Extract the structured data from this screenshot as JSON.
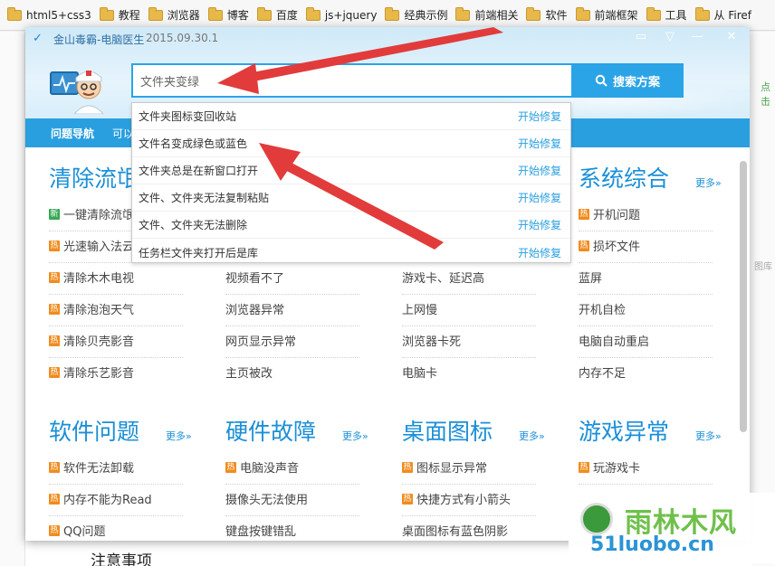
{
  "bookmarks": [
    "html5+css3",
    "教程",
    "浏览器",
    "博客",
    "百度",
    "js+jquery",
    "经典示例",
    "前端相关",
    "软件",
    "前端框架",
    "工具",
    "从 Firef"
  ],
  "background": {
    "right_label": "图库",
    "right_green": "点击",
    "bottom_text": "注意事项"
  },
  "app": {
    "title": "金山毒霸-电脑医生",
    "date": "2015.09.30.1"
  },
  "search": {
    "value": "文件夹变绿",
    "button_label": "搜索方案"
  },
  "nav": {
    "label": "问题导航",
    "extra": "可以"
  },
  "dropdown": [
    {
      "label": "文件夹图标变回收站",
      "action": "开始修复"
    },
    {
      "label": "文件名变成绿色或蓝色",
      "action": "开始修复"
    },
    {
      "label": "文件夹总是在新窗口打开",
      "action": "开始修复"
    },
    {
      "label": "文件、文件夹无法复制粘贴",
      "action": "开始修复"
    },
    {
      "label": "文件、文件夹无法删除",
      "action": "开始修复"
    },
    {
      "label": "任务栏文件夹打开后是库",
      "action": "开始修复"
    }
  ],
  "sections_top": {
    "col1_title": "清除流氓",
    "col4_title": "系统综合",
    "more": "更多»",
    "col1_items": [
      "一键清除流氓",
      "光速输入法云",
      "清除木木电视",
      "清除泡泡天气",
      "清除贝壳影音",
      "清除乐艺影音"
    ],
    "col2_items": [
      "视频看不了",
      "浏览器异常",
      "网页显示异常",
      "主页被改"
    ],
    "col3_items": [
      "游戏卡、延迟高",
      "上网慢",
      "浏览器卡死",
      "电脑卡"
    ],
    "col4_items": [
      "开机问题",
      "损坏文件",
      "蓝屏",
      "开机自检",
      "电脑自动重启",
      "内存不足"
    ]
  },
  "sections_bottom": {
    "titles": [
      "软件问题",
      "硬件故障",
      "桌面图标",
      "游戏异常"
    ],
    "more": "更多»",
    "col1_items": [
      "软件无法卸载",
      "内存不能为Read",
      "QQ问题"
    ],
    "col2_items": [
      "电脑没声音",
      "摄像头无法使用",
      "键盘按键错乱"
    ],
    "col3_items": [
      "图标显示异常",
      "快捷方式有小箭头",
      "桌面图标有蓝色阴影"
    ],
    "col4_items": [
      "玩游戏卡"
    ]
  },
  "badges": {
    "hot": "热",
    "new": "新"
  },
  "watermark": {
    "title": "雨林木风",
    "url": "51luobo.cn"
  },
  "colors": {
    "accent": "#2aa4e6",
    "nav": "#2a9fe0",
    "hot_badge": "#f08c1e",
    "arrow": "#e23b3b"
  }
}
